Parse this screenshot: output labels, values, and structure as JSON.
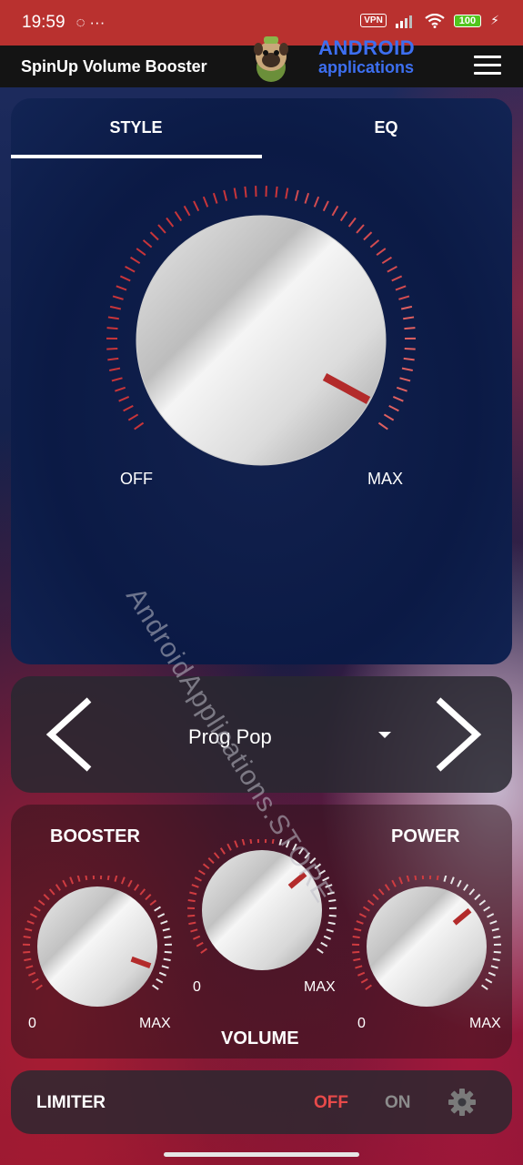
{
  "status_bar": {
    "time": "19:59",
    "left_icons": "◌ ···",
    "vpn": "VPN",
    "battery": "100"
  },
  "app_bar": {
    "title": "SpinUp Volume Booster",
    "logo_line1": "ANDROID",
    "logo_line2": "applications",
    "menu_icon": "hamburger-menu-icon"
  },
  "tabs": [
    {
      "label": "STYLE",
      "active": true
    },
    {
      "label": "EQ",
      "active": false
    }
  ],
  "style_knob": {
    "min_label": "OFF",
    "max_label": "MAX"
  },
  "preset": {
    "name": "Prog Pop",
    "prev_icon": "chevron-left-icon",
    "next_icon": "chevron-right-icon"
  },
  "knobs": {
    "booster": {
      "title": "BOOSTER",
      "min": "0",
      "max": "MAX"
    },
    "volume": {
      "title": "VOLUME",
      "min": "0",
      "max": "MAX"
    },
    "power": {
      "title": "POWER",
      "min": "0",
      "max": "MAX"
    }
  },
  "limiter": {
    "title": "LIMITER",
    "off_label": "OFF",
    "on_label": "ON",
    "state": "OFF",
    "settings_icon": "gear-icon"
  },
  "watermark": "AndroidApplications.STORE",
  "colors": {
    "accent_red": "#e84a4a",
    "status_bar": "#b9312f",
    "logo_blue": "#3d6ff0"
  }
}
